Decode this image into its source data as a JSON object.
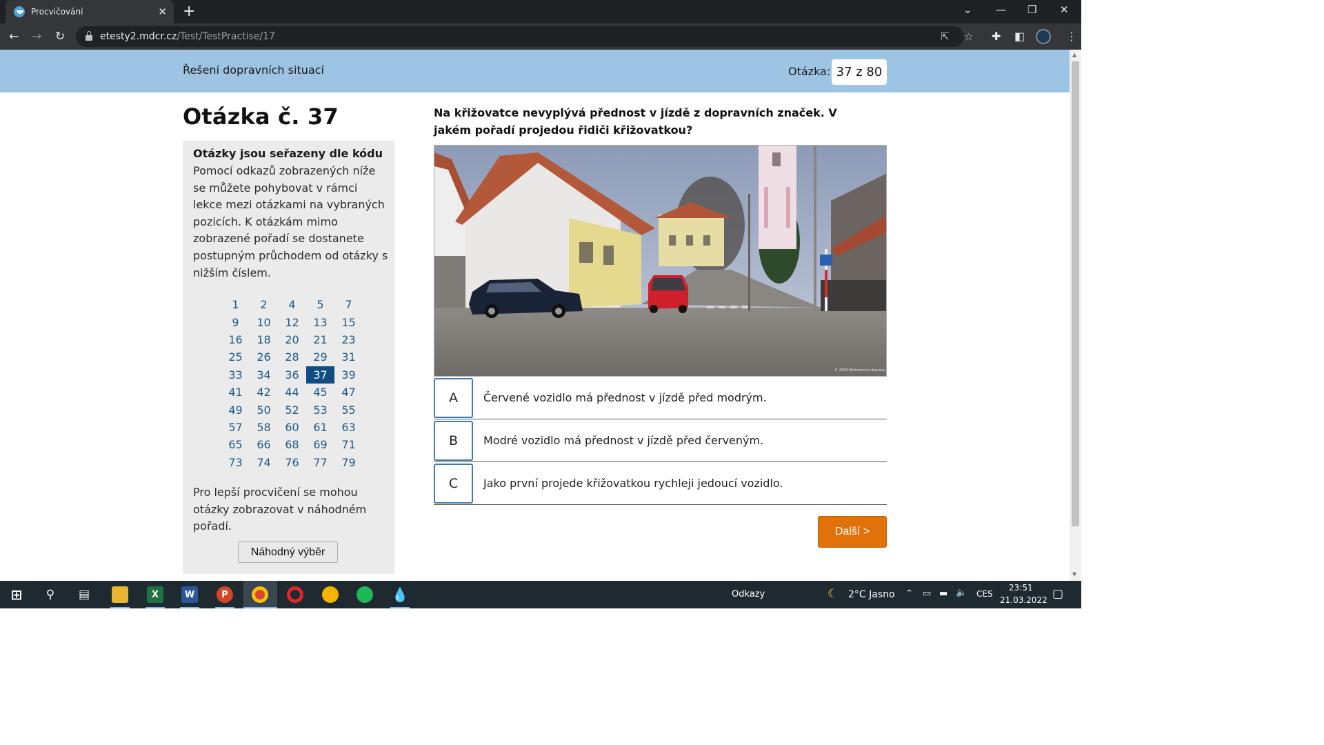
{
  "browser": {
    "tab_title": "Procvičování",
    "tab_close": "✕",
    "new_tab": "+",
    "url_host": "etesty2.mdcr.cz",
    "url_path": "/Test/TestPractise/17"
  },
  "header": {
    "section_title": "Řešení dopravních situací",
    "question_label": "Otázka:",
    "question_counter": "37 z 80"
  },
  "main": {
    "heading": "Otázka č. 37",
    "question_text": "Na křižovatce nevyplývá přednost v jízdě z dopravních značek. V jakém pořadí projedou řidiči křižovatkou?",
    "photo_credit": "© 2006 Ministerstvo dopravy"
  },
  "sidebar": {
    "title": "Otázky jsou seřazeny dle kódu",
    "description": "Pomocí odkazů zobrazených níže se můžete pohybovat v rámci lekce mezi otázkami na vybraných pozicích. K otázkám mimo zobrazené pořadí se dostanete postupným průchodem od otázky s nižším číslem.",
    "numbers": [
      "1",
      "2",
      "4",
      "5",
      "7",
      "9",
      "10",
      "12",
      "13",
      "15",
      "16",
      "18",
      "20",
      "21",
      "23",
      "25",
      "26",
      "28",
      "29",
      "31",
      "33",
      "34",
      "36",
      "37",
      "39",
      "41",
      "42",
      "44",
      "45",
      "47",
      "49",
      "50",
      "52",
      "53",
      "55",
      "57",
      "58",
      "60",
      "61",
      "63",
      "65",
      "66",
      "68",
      "69",
      "71",
      "73",
      "74",
      "76",
      "77",
      "79"
    ],
    "active_number": "37",
    "random_text": "Pro lepší procvičení se mohou otázky zobrazovat v náhodném pořadí.",
    "random_button": "Náhodný výběr"
  },
  "answers": [
    {
      "letter": "A",
      "text": "Červené vozidlo má přednost v jízdě před modrým."
    },
    {
      "letter": "B",
      "text": "Modré vozidlo má přednost v jízdě před červeným."
    },
    {
      "letter": "C",
      "text": "Jako první projede křižovatkou rychleji jedoucí vozidlo."
    }
  ],
  "next_button": "Další >",
  "taskbar": {
    "links_label": "Odkazy",
    "weather": "2°C  Jasno",
    "language": "CES",
    "time": "23:51",
    "date": "21.03.2022"
  },
  "colors": {
    "banner": "#9ec4e4",
    "active_number": "#0f4d82",
    "link": "#1b5a8a",
    "next_button": "#e07209",
    "answer_border": "#3e79ad"
  }
}
